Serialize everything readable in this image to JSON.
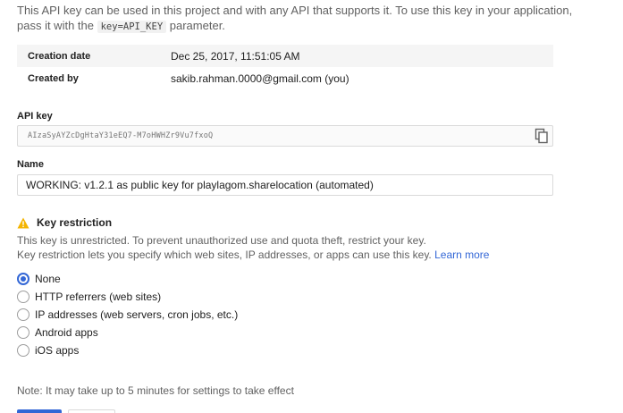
{
  "intro": {
    "text_before": "This API key can be used in this project and with any API that supports it. To use this key in your application, pass it with the ",
    "code": "key=API_KEY",
    "text_after": " parameter."
  },
  "meta": [
    {
      "label": "Creation date",
      "value": "Dec 25, 2017, 11:51:05 AM"
    },
    {
      "label": "Created by",
      "value": "sakib.rahman.0000@gmail.com (you)"
    }
  ],
  "api_key": {
    "label": "API key",
    "value": "AIzaSyAYZcDgHtaY31eEQ7-M7oHWHZr9Vu7fxoQ",
    "copy_icon": "copy-icon"
  },
  "name_field": {
    "label": "Name",
    "value": "WORKING: v1.2.1 as public key for playlagom.sharelocation (automated)"
  },
  "restriction": {
    "title": "Key restriction",
    "warning_icon": "warning-icon",
    "line1": "This key is unrestricted. To prevent unauthorized use and quota theft, restrict your key.",
    "line2": "Key restriction lets you specify which web sites, IP addresses, or apps can use this key. ",
    "learn_more": "Learn more",
    "options": [
      "None",
      "HTTP referrers (web sites)",
      "IP addresses (web servers, cron jobs, etc.)",
      "Android apps",
      "iOS apps"
    ],
    "selected": "None"
  },
  "note": "Note: It may take up to 5 minutes for settings to take effect",
  "colors": {
    "accent": "#3367d6",
    "warning": "#f4b400"
  }
}
